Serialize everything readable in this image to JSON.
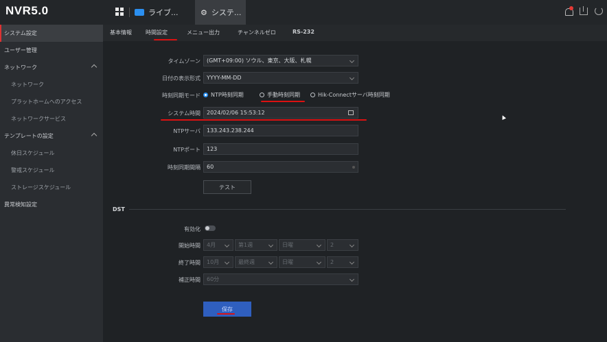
{
  "topbar": {
    "logo": "NVR5.0",
    "tabs": [
      {
        "label": "ライブ..."
      },
      {
        "label": "システ..."
      }
    ]
  },
  "sidebar": {
    "items": [
      {
        "label": "システム設定",
        "active": true
      },
      {
        "label": "ユーザー管理"
      },
      {
        "label": "ネットワーク",
        "expanded": true
      },
      {
        "label": "ネットワーク",
        "sub": true
      },
      {
        "label": "プラットホームへのアクセス",
        "sub": true
      },
      {
        "label": "ネットワークサービス",
        "sub": true
      },
      {
        "label": "テンプレートの設定",
        "expanded": true
      },
      {
        "label": "休日スケジュール",
        "sub": true
      },
      {
        "label": "警戒スケジュール",
        "sub": true
      },
      {
        "label": "ストレージスケジュール",
        "sub": true
      },
      {
        "label": "異常検知設定"
      }
    ]
  },
  "subtabs": [
    {
      "label": "基本情報"
    },
    {
      "label": "時間設定",
      "active": true
    },
    {
      "label": "メニュー出力"
    },
    {
      "label": "チャンネルゼロ"
    },
    {
      "label": "RS-232"
    }
  ],
  "form": {
    "timezone": {
      "label": "タイムゾーン",
      "value": "(GMT+09:00) ソウル、東京、大阪、札幌"
    },
    "date_format": {
      "label": "日付の表示形式",
      "value": "YYYY-MM-DD"
    },
    "sync_mode": {
      "label": "時刻同期モード",
      "options": [
        {
          "label": "NTP時刻同期",
          "selected": true
        },
        {
          "label": "手動時刻同期"
        },
        {
          "label": "Hik-Connectサーバ時刻同期"
        }
      ]
    },
    "system_time": {
      "label": "システム時間",
      "value": "2024/02/06 15:53:12"
    },
    "ntp_server": {
      "label": "NTPサーバ",
      "value": "133.243.238.244"
    },
    "ntp_port": {
      "label": "NTPポート",
      "value": "123"
    },
    "sync_interval": {
      "label": "時刻同期間隔",
      "value": "60"
    },
    "test_button": "テスト"
  },
  "dst": {
    "title": "DST",
    "enable_label": "有効化",
    "start_label": "開始時間",
    "start_values": [
      "4月",
      "第1週",
      "日曜",
      "2"
    ],
    "end_label": "終了時間",
    "end_values": [
      "10月",
      "最終週",
      "日曜",
      "2"
    ],
    "offset_label": "補正時間",
    "offset_value": "60分"
  },
  "save_button": "保存",
  "colors": {
    "accent": "#2b8ff0",
    "highlight": "#d11111",
    "save": "#2f5fbf"
  }
}
